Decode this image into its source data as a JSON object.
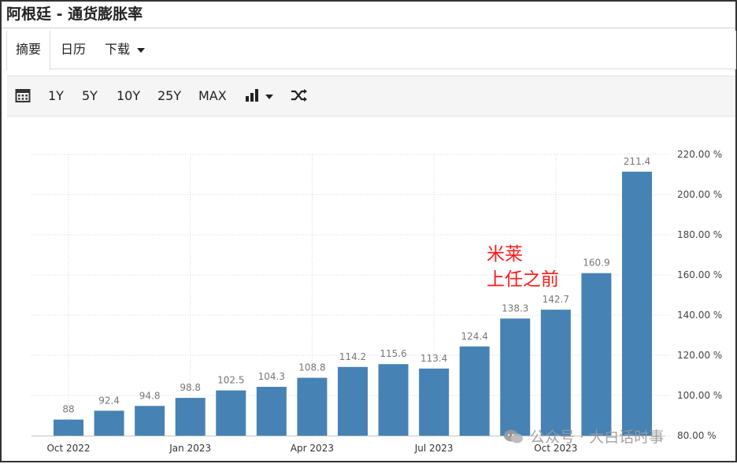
{
  "page": {
    "title": "阿根廷 - 通货膨胀率"
  },
  "tabs": [
    {
      "label": "摘要"
    },
    {
      "label": "日历"
    },
    {
      "label": "下载"
    }
  ],
  "toolbar": {
    "ranges": [
      "1Y",
      "5Y",
      "10Y",
      "25Y",
      "MAX"
    ],
    "icons": [
      "calendar-icon",
      "bar-chart-icon",
      "chevron-down-icon",
      "shuffle-icon"
    ]
  },
  "annotation": {
    "line1": "米莱",
    "line2": "上任之前"
  },
  "watermark": {
    "text": "公众号 · 大白话时事"
  },
  "colors": {
    "bar": "#4682b4",
    "annotation": "#ff1a1a",
    "grid": "#d9d9d9"
  },
  "chart_data": {
    "type": "bar",
    "categories": [
      "2022-10",
      "2022-11",
      "2022-12",
      "2023-01",
      "2023-02",
      "2023-03",
      "2023-04",
      "2023-05",
      "2023-06",
      "2023-07",
      "2023-08",
      "2023-09",
      "2023-10",
      "2023-11",
      "2023-12"
    ],
    "values": [
      88,
      92.4,
      94.8,
      98.8,
      102.5,
      104.3,
      108.8,
      114.2,
      115.6,
      113.4,
      124.4,
      138.3,
      142.7,
      160.9,
      211.4
    ],
    "value_labels": [
      "88",
      "92.4",
      "94.8",
      "98.8",
      "102.5",
      "104.3",
      "108.8",
      "114.2",
      "115.6",
      "113.4",
      "124.4",
      "138.3",
      "142.7",
      "160.9",
      "211.4"
    ],
    "x_tick_labels": [
      "Oct 2022",
      "Jan 2023",
      "Apr 2023",
      "Jul 2023",
      "Oct 2023"
    ],
    "x_tick_indices": [
      0,
      3,
      6,
      9,
      12
    ],
    "y_ticks": [
      80,
      100,
      120,
      140,
      160,
      180,
      200,
      220
    ],
    "y_tick_labels": [
      "80.00 %",
      "100.00 %",
      "120.00 %",
      "140.00 %",
      "160.00 %",
      "180.00 %",
      "200.00 %",
      "220.00 %"
    ],
    "ylim": [
      80,
      220
    ],
    "y_axis_side": "right",
    "grid": "dotted",
    "title": "",
    "xlabel": "",
    "ylabel": ""
  }
}
